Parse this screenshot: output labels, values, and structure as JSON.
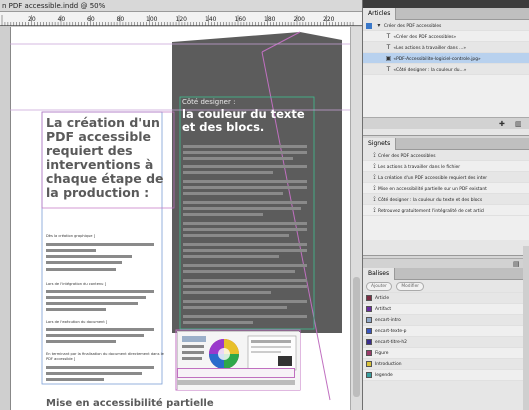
{
  "document": {
    "title": "n PDF accessible.indd @ 50%",
    "ruler_labels": [
      "20",
      "40",
      "60",
      "80",
      "100",
      "120",
      "140",
      "160",
      "180",
      "200",
      "220"
    ],
    "main_heading": "La création d'un PDF accessible requiert des interventions à chaque étape de la production :",
    "labels": [
      "Dès la création graphique ]",
      "Lors de l'intégration du contenu ]",
      "Lors de l'exécution du document ]",
      "En terminant par la finalisation du document directement dans le PDF accessible ]"
    ],
    "side_heading_small": "Côté designer :",
    "side_heading": "la couleur du texte et des blocs.",
    "footer_heading": "Mise en accessibilité partielle",
    "colors": {
      "dark_panel": "#5a5a5a",
      "frame": "#c070c0",
      "text_frame": "#7c9fd6",
      "accent": "#3a78c9"
    }
  },
  "articles_panel": {
    "tab": "Articles",
    "root": "Créer des PDF accessibles",
    "items": [
      {
        "label": "«Créer des PDF accessibles»",
        "icon": "text-T-icon",
        "selected": false
      },
      {
        "label": "«Les actions à travailler dans ...»",
        "icon": "text-T-icon",
        "selected": false
      },
      {
        "label": "«PDF-Accessibilite-logiciel-controle.jpg»",
        "icon": "image-icon",
        "selected": true
      },
      {
        "label": "«Côté designer : la couleur du...»",
        "icon": "text-T-icon",
        "selected": false
      }
    ]
  },
  "bookmarks_panel": {
    "tab": "Signets",
    "items": [
      "Créer des PDF accessibles",
      "Les actions à travailler dans le fichier",
      "La création d'un PDF accessible requiert des inter",
      "Mise en accessibilité partielle sur un PDF existant",
      "Côté designer : la couleur du texte et des blocs",
      "Retrouvez gratuitement l'intégralité de cet articl"
    ]
  },
  "tags_panel": {
    "tab": "Balises",
    "add_label": "Ajouter",
    "edit_label": "Modifier",
    "items": [
      {
        "label": "Article",
        "color": "#7b2d43"
      },
      {
        "label": "Artifact",
        "color": "#6a2ea0"
      },
      {
        "label": "encart-intro",
        "color": "#8fa8c8"
      },
      {
        "label": "encart-texte-p",
        "color": "#3a57c0"
      },
      {
        "label": "encart-titre-h2",
        "color": "#3a2e8f"
      },
      {
        "label": "Figure",
        "color": "#9b3a6a"
      },
      {
        "label": "Introduction",
        "color": "#d9c23a"
      },
      {
        "label": "legende",
        "color": "#3aa0a0"
      }
    ]
  }
}
